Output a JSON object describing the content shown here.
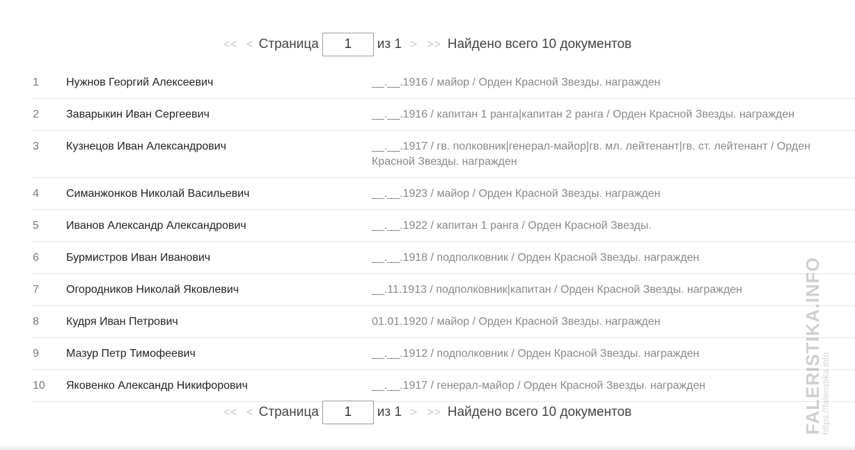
{
  "pagination": {
    "first": "<<",
    "prev": "<",
    "page_label": "Страница",
    "current_page": "1",
    "of_label": "из 1",
    "next": ">",
    "last": ">>",
    "found_text": "Найдено всего 10 документов"
  },
  "results": [
    {
      "num": "1",
      "name": "Нужнов Георгий Алексеевич",
      "info": "__.__.1916 /  майор /  Орден Красной Звезды. награжден"
    },
    {
      "num": "2",
      "name": "Заварыкин Иван Сергеевич",
      "info": "__.__.1916 /  капитан 1 ранга|капитан 2 ранга /  Орден Красной Звезды. награжден"
    },
    {
      "num": "3",
      "name": "Кузнецов Иван Александрович",
      "info": "__.__.1917 /  гв. полковник|генерал-майор|гв. мл. лейтенант|гв. ст. лейтенант /  Орден Красной Звезды. награжден"
    },
    {
      "num": "4",
      "name": "Симанжонков Николай Васильевич",
      "info": "__.__.1923 /  майор /  Орден Красной Звезды. награжден"
    },
    {
      "num": "5",
      "name": "Иванов Александр Александрович",
      "info": "__.__.1922 /  капитан 1 ранга /  Орден Красной Звезды."
    },
    {
      "num": "6",
      "name": "Бурмистров Иван Иванович",
      "info": "__.__.1918 /  подполковник /  Орден Красной Звезды. награжден"
    },
    {
      "num": "7",
      "name": "Огородников Николай Яковлевич",
      "info": "__.11.1913 /  подполковник|капитан /  Орден Красной Звезды. награжден"
    },
    {
      "num": "8",
      "name": "Кудря Иван Петрович",
      "info": "01.01.1920 /  майор /  Орден Красной Звезды. награжден"
    },
    {
      "num": "9",
      "name": "Мазур Петр Тимофеевич",
      "info": "__.__.1912 /  подполковник /  Орден Красной Звезды. награжден"
    },
    {
      "num": "10",
      "name": "Яковенко Александр Никифорович",
      "info": "__.__.1917 /  генерал-майор /  Орден Красной Звезды. награжден"
    }
  ],
  "watermark": {
    "brand": "FALERISTIKA.INFO",
    "url": "https://faleristika.info"
  }
}
